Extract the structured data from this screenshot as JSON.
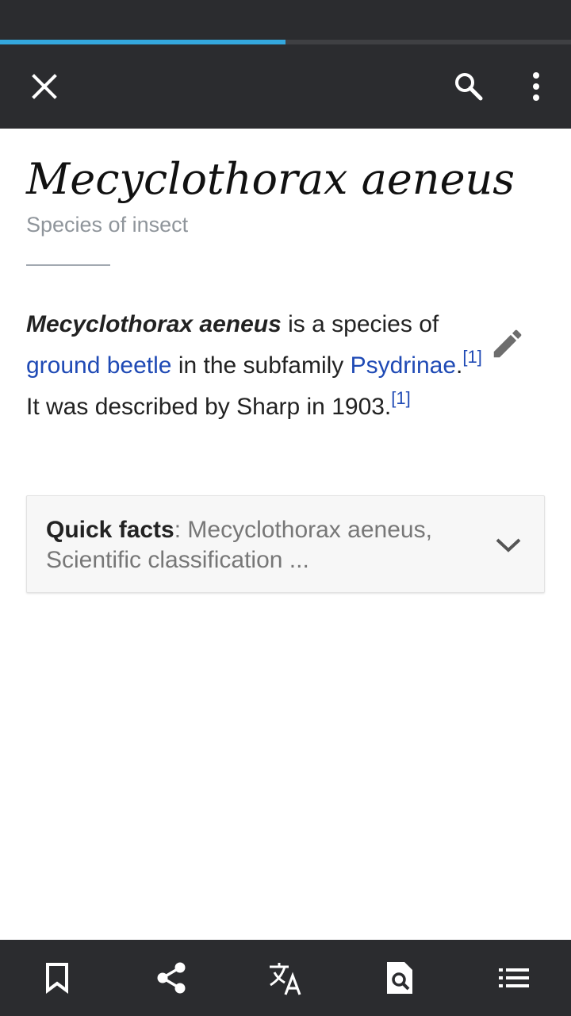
{
  "page_load": {
    "progress": 0.5,
    "accent": "#34a8de"
  },
  "toolbar": {
    "close_icon": "close-icon",
    "search_icon": "search-icon",
    "more_icon": "more-vert-icon"
  },
  "article": {
    "title": "Mecyclothorax aeneus",
    "description": "Species of insect",
    "intro": {
      "bold_name": "Mecyclothorax aeneus",
      "text1": " is a species of ",
      "link1": "ground beetle",
      "text2": " in the subfamily ",
      "link2": "Psydrinae",
      "text3": ".",
      "ref1": "[1]",
      "text4": " It was described by Sharp in 1903.",
      "ref2": "[1]"
    },
    "edit_icon": "pencil-icon",
    "quick_facts": {
      "label": "Quick facts",
      "separator": ": ",
      "summary": "Mecyclothorax aeneus, Scientific classification ...",
      "chevron_icon": "chevron-down-icon"
    }
  },
  "bottom_bar": {
    "items": [
      {
        "icon": "bookmark-icon"
      },
      {
        "icon": "share-icon"
      },
      {
        "icon": "translate-icon"
      },
      {
        "icon": "find-in-page-icon"
      },
      {
        "icon": "contents-list-icon"
      }
    ]
  },
  "colors": {
    "bar_background": "#2b2c2f",
    "link": "#1f4ab5",
    "text": "#222222",
    "muted": "#8f959b"
  }
}
